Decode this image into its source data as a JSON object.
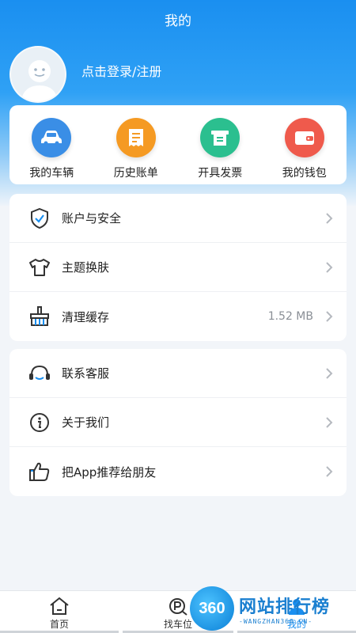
{
  "header": {
    "title": "我的"
  },
  "profile": {
    "login_text": "点击登录/注册"
  },
  "quick_actions": [
    {
      "label": "我的车辆",
      "icon": "car-icon",
      "color": "#3a8ee6"
    },
    {
      "label": "历史账单",
      "icon": "bill-icon",
      "color": "#f59a23"
    },
    {
      "label": "开具发票",
      "icon": "invoice-icon",
      "color": "#2bbf8f"
    },
    {
      "label": "我的钱包",
      "icon": "wallet-icon",
      "color": "#ef5a4c"
    }
  ],
  "menu_group_1": [
    {
      "label": "账户与安全",
      "icon": "shield-icon",
      "value": ""
    },
    {
      "label": "主题换肤",
      "icon": "shirt-icon",
      "value": ""
    },
    {
      "label": "清理缓存",
      "icon": "broom-icon",
      "value": "1.52 MB"
    }
  ],
  "menu_group_2": [
    {
      "label": "联系客服",
      "icon": "headset-icon",
      "value": ""
    },
    {
      "label": "关于我们",
      "icon": "info-icon",
      "value": ""
    },
    {
      "label": "把App推荐给朋友",
      "icon": "thumbs-up-icon",
      "value": ""
    }
  ],
  "tabbar": [
    {
      "label": "首页",
      "icon": "home-icon",
      "active": false
    },
    {
      "label": "找车位",
      "icon": "parking-search-icon",
      "active": false
    },
    {
      "label": "我的",
      "icon": "profile-icon",
      "active": true
    }
  ],
  "watermark": {
    "badge": "360",
    "name": "网站排行榜",
    "url": "-WANGZHAN360.CN-"
  },
  "colors": {
    "primary": "#1a8ff0",
    "background": "#f2f5f9"
  }
}
